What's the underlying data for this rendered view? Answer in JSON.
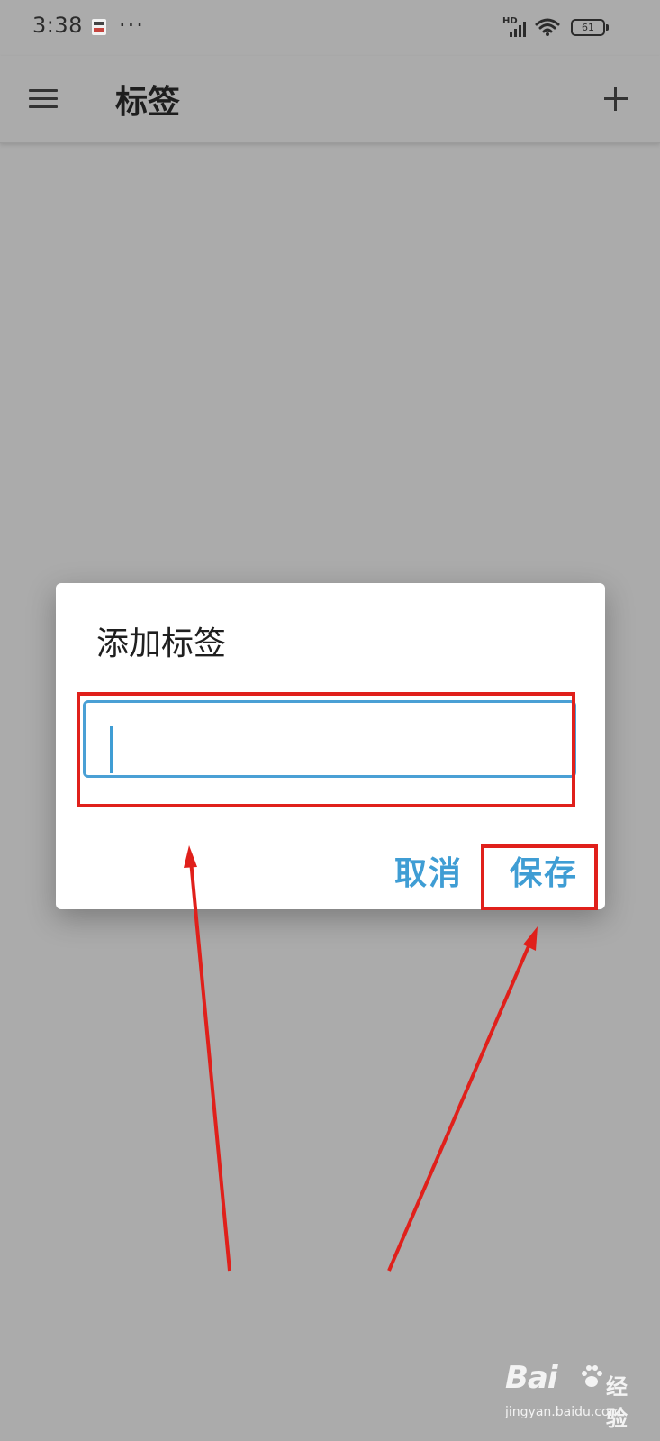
{
  "status_bar": {
    "time": "3:38",
    "more": "···",
    "network_label": "HD",
    "battery": "61"
  },
  "app_bar": {
    "title": "标签"
  },
  "dialog": {
    "title": "添加标签",
    "input_value": "",
    "cancel_label": "取消",
    "save_label": "保存"
  },
  "annotations": {
    "highlight_color": "#e0201b"
  },
  "watermark": {
    "logo": "Bai",
    "logo_suffix": "经验",
    "url": "jingyan.baidu.com"
  },
  "colors": {
    "background": "#ababab",
    "accent": "#3f9dd4",
    "dialog": "#ffffff"
  }
}
